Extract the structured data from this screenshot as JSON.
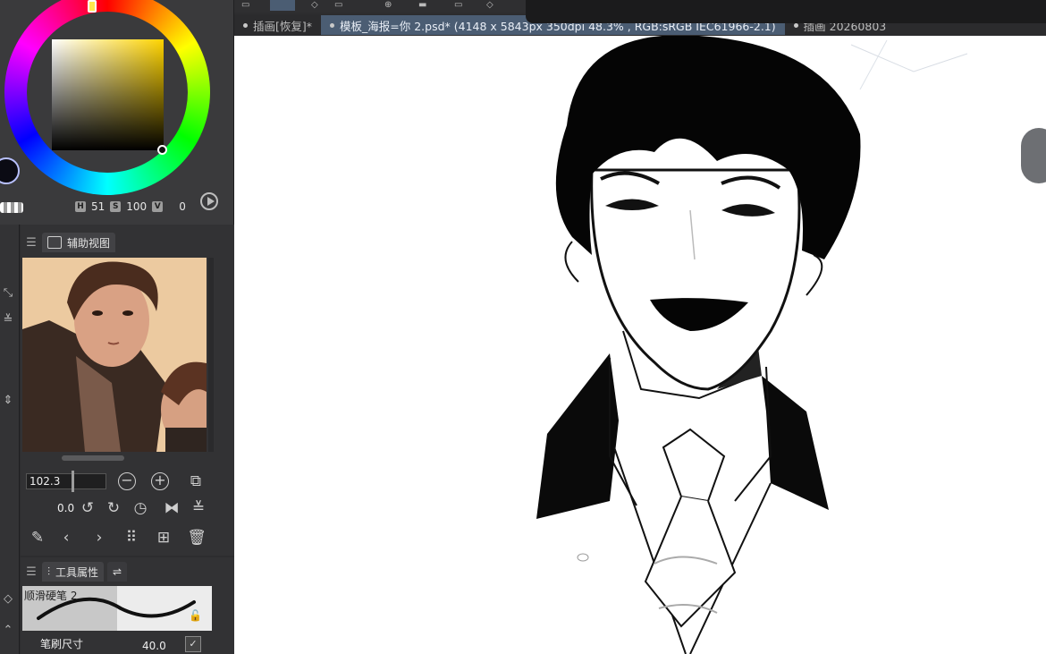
{
  "color": {
    "h_label": "H",
    "h": "51",
    "s_label": "S",
    "s": "100",
    "v_label": "V",
    "v": "0",
    "current_color": "#0b0b14",
    "hue_color": "#ffd400"
  },
  "tabs": [
    {
      "label": "插画[恢复]*",
      "active": false
    },
    {
      "label": "模板_海报=你 2.psd* (4148 x 5843px 350dpi 48.3% , RGB:sRGB IEC61966-2.1)",
      "active": true
    },
    {
      "label": "插画 20260803",
      "active": false
    }
  ],
  "sub_view": {
    "tab_label": "辅助视图",
    "zoom": "102.3",
    "rotation": "0.0"
  },
  "tool_property": {
    "tab_label": "工具属性",
    "brush_name": "顺滑硬笔 2",
    "size_label": "笔刷尺寸",
    "size_value": "40.0"
  },
  "icons": [
    "menu-icon",
    "navigator-icon",
    "zoom-out-icon",
    "zoom-in-icon",
    "fit-icon",
    "rotate-left-icon",
    "rotate-right-icon",
    "reset-rotation-icon",
    "flip-horizontal-icon",
    "flip-vertical-icon",
    "eyedropper-icon",
    "previous-icon",
    "next-icon",
    "grid-icon",
    "import-icon",
    "trash-icon",
    "lock-icon",
    "canvas-rotate-icon"
  ]
}
